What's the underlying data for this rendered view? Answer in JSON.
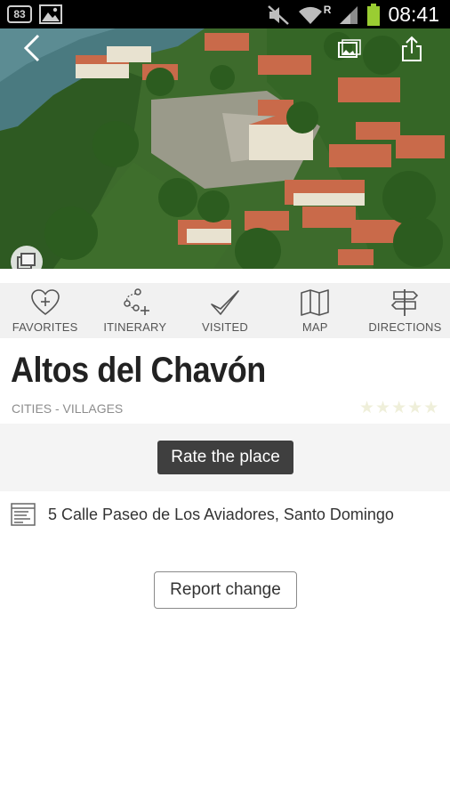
{
  "status_bar": {
    "notification_count": "83",
    "notification_icon": "chat-bubble-icon",
    "image_icon": "picture-icon",
    "mute_icon": "mute-icon",
    "wifi_icon": "wifi-icon",
    "roaming_label": "R",
    "signal_icon": "signal-bars-icon",
    "battery_icon": "battery-icon",
    "battery_color": "#9acd32",
    "time": "08:41"
  },
  "hero": {
    "back_icon": "chevron-left-icon",
    "gallery_icon": "gallery-icon",
    "share_icon": "share-icon",
    "photos_icon": "photos-stack-icon"
  },
  "actions": [
    {
      "label": "FAVORITES",
      "icon": "heart-plus-icon"
    },
    {
      "label": "ITINERARY",
      "icon": "route-plus-icon"
    },
    {
      "label": "VISITED",
      "icon": "checkmark-icon"
    },
    {
      "label": "MAP",
      "icon": "map-icon"
    },
    {
      "label": "DIRECTIONS",
      "icon": "signpost-icon"
    }
  ],
  "place": {
    "title": "Altos del Chavón",
    "category": "CITIES - VILLAGES",
    "rating": 0,
    "rating_max": 5
  },
  "rate_button": "Rate the place",
  "address": {
    "icon": "address-card-icon",
    "text": "5 Calle Paseo de Los Aviadores, Santo Domingo"
  },
  "report_button": "Report change",
  "colors": {
    "status_bar_bg": "#000000",
    "actions_bg": "#f1f1f1",
    "rate_button_bg": "#3f3f3f",
    "star_empty": "#efefda"
  }
}
